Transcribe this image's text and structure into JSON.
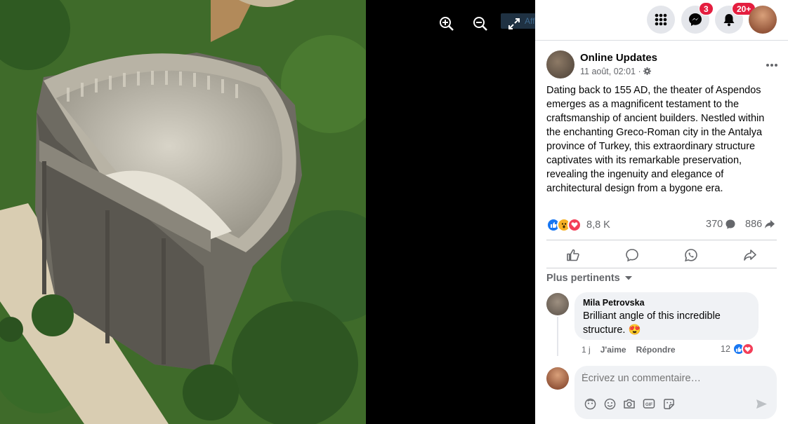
{
  "viewer": {
    "fullscreen_tooltip": "Afficher Plein écran",
    "icons": [
      "zoom-in-icon",
      "zoom-out-icon",
      "fullscreen-icon"
    ]
  },
  "topbar": {
    "messenger_badge": "3",
    "notifications_badge": "20+"
  },
  "post": {
    "author": "Online Updates",
    "date": "11 août, 02:01 · ",
    "text": "Dating back to 155 AD, the theater of Aspendos emerges as a magnificent testament to the craftsmanship of ancient builders. Nestled within the enchanting Greco-Roman city in the Antalya province of Turkey, this extraordinary structure captivates with its remarkable preservation, revealing the ingenuity and elegance of architectural design from a bygone era.",
    "reaction_count": "8,8 K",
    "comment_count": "370",
    "share_count": "886"
  },
  "comments": {
    "sort_label": "Plus pertinents",
    "items": [
      {
        "author": "Mila Petrovska",
        "text": "Brilliant angle of this incredible structure. 😍",
        "time": "1 j",
        "like_label": "J'aime",
        "reply_label": "Répondre",
        "reaction_count": "12"
      }
    ],
    "composer_placeholder": "Écrivez un commentaire…"
  },
  "colors": {
    "accent": "#1877f2",
    "badge": "#e41e3f",
    "love": "#f33e58",
    "panel_bg": "#ffffff"
  }
}
